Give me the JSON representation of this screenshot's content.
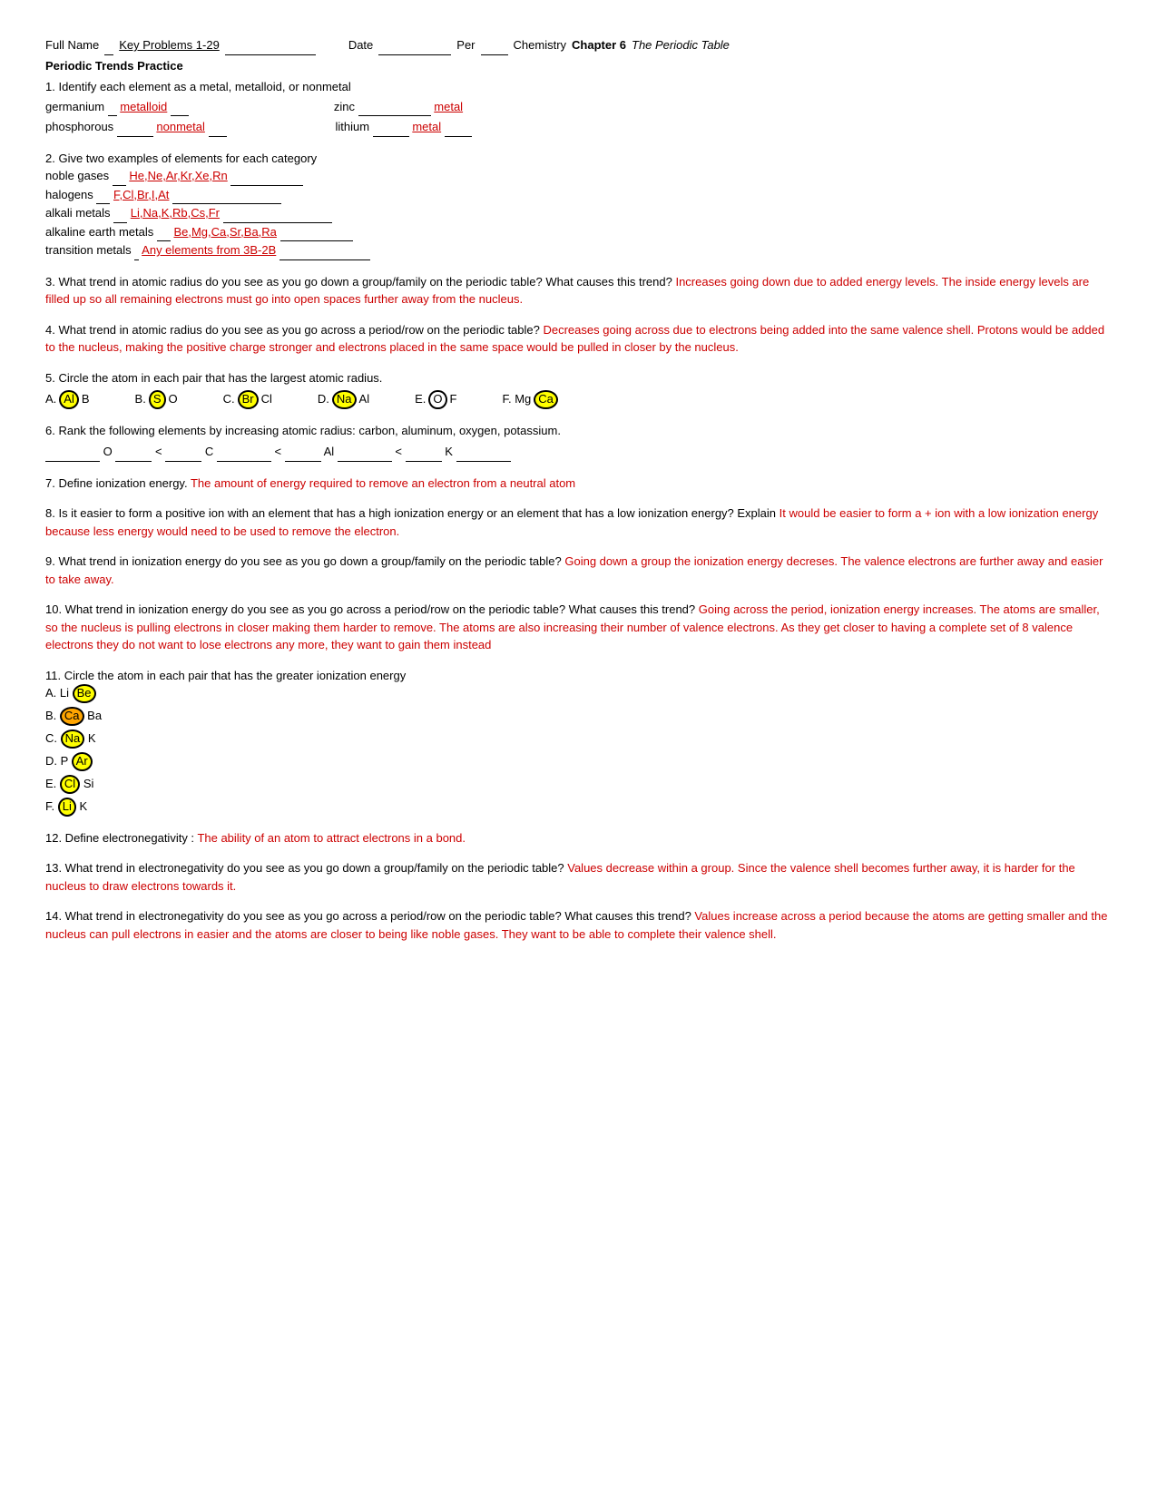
{
  "header": {
    "full_name_label": "Full Name",
    "full_name_value": "Key Problems 1-29",
    "date_label": "Date",
    "per_label": "Per",
    "course_bold": "Chapter 6",
    "course_italic": "The Periodic Table",
    "chemistry_label": "Chemistry"
  },
  "section_title": "Periodic Trends Practice",
  "questions": {
    "q1": {
      "text": "1. Identify each element as a metal, metalloid, or nonmetal",
      "items": [
        {
          "element": "germanium",
          "answer": "metalloid"
        },
        {
          "element": "zinc",
          "answer": "metal"
        },
        {
          "element": "phosphorous",
          "answer": "nonmetal"
        },
        {
          "element": "lithium",
          "answer": "metal"
        }
      ]
    },
    "q2": {
      "text": "2. Give two examples of elements for each category",
      "items": [
        {
          "category": "noble gases",
          "answer": "He,Ne,Ar,Kr,Xe,Rn"
        },
        {
          "category": "halogens",
          "answer": "F,Cl,Br,I,At"
        },
        {
          "category": "alkali metals",
          "answer": "Li,Na,K,Rb,Cs,Fr"
        },
        {
          "category": "alkaline earth metals",
          "answer": "Be,Mg,Ca,Sr,Ba,Ra"
        },
        {
          "category": "transition metals",
          "answer": "Any elements from 3B-2B"
        }
      ]
    },
    "q3": {
      "text": "3. What trend in atomic radius do you see as you go down a group/family on the periodic table? What causes this trend?",
      "answer": "Increases going down due to added energy levels.  The inside energy levels are filled up so all remaining electrons must go into open spaces further away from the nucleus."
    },
    "q4": {
      "text": "4. What trend in atomic radius do you see as you go across a period/row on the periodic table?",
      "answer": "Decreases going across due to electrons being added into the same valence shell.  Protons would be added to the nucleus, making the positive charge stronger and electrons placed in the same space would be pulled in closer by the nucleus."
    },
    "q5": {
      "text": "5. Circle the atom in each pair that has the largest atomic radius.",
      "pairs": [
        {
          "label": "A.",
          "items": [
            {
              "val": "Al",
              "circled": true
            },
            {
              "val": "B",
              "circled": false
            }
          ]
        },
        {
          "label": "B.",
          "items": [
            {
              "val": "S",
              "circled": false
            },
            {
              "val": "O",
              "circled": false
            }
          ]
        },
        {
          "label": "C.",
          "items": [
            {
              "val": "Br",
              "circled": true
            },
            {
              "val": "Cl",
              "circled": false
            }
          ]
        },
        {
          "label": "D.",
          "items": [
            {
              "val": "Na",
              "circled": true
            },
            {
              "val": "Al",
              "circled": false
            }
          ]
        },
        {
          "label": "E.",
          "items": [
            {
              "val": "O",
              "circled": false
            },
            {
              "val": "F",
              "circled": false
            }
          ]
        },
        {
          "label": "F.",
          "items": [
            {
              "val": "Mg",
              "circled": false
            },
            {
              "val": "Ca",
              "circled": true
            }
          ]
        }
      ]
    },
    "q6": {
      "text": "6. Rank the following elements by increasing atomic radius: carbon, aluminum, oxygen, potassium.",
      "ranking": "___________O_________<_________C___________<_________Al___________<_______K___________"
    },
    "q7": {
      "text": "7. Define ionization energy.",
      "answer": "The amount of energy required to remove an electron from a neutral atom"
    },
    "q8": {
      "text": "8. Is it easier to form a positive ion with an element that has a high ionization energy or an element that has a low ionization energy? Explain",
      "answer": "It would be easier to form a + ion with a low ionization energy because less energy would need to be used to remove the electron."
    },
    "q9": {
      "text": "9. What trend in ionization energy do you see as you go down a group/family on the periodic table?",
      "answer": "Going down a group the ionization energy decreses.  The valence electrons are further away and easier to take away."
    },
    "q10": {
      "text": "10. What trend in ionization energy do you see as you go across a period/row on the periodic table? What causes this trend?",
      "answer": "Going across the period, ionization energy increases.  The atoms are smaller, so the nucleus is pulling electrons in closer making them harder to remove.  The atoms are also increasing their number of valence electrons.  As they get closer to having a complete set of 8 valence electrons they do not want to lose electrons any more, they want to gain them instead"
    },
    "q11": {
      "text": "11. Circle the atom in each pair that has the greater ionization energy",
      "pairs": [
        {
          "label": "A. Li",
          "circled": "Be"
        },
        {
          "label": "B.",
          "first": "Ca",
          "circled_first": true,
          "second": "Ba"
        },
        {
          "label": "C.",
          "first": "Na",
          "circled_first": true,
          "second": "K"
        },
        {
          "label": "D. P",
          "circled": "Ar"
        },
        {
          "label": "E.",
          "first": "Cl",
          "circled_first": true,
          "second": "Si"
        },
        {
          "label": "F.",
          "first": "Li",
          "circled_first": true,
          "second": "K"
        }
      ]
    },
    "q12": {
      "text": "12. Define electronegativity :",
      "answer": "The ability of an atom to attract electrons in a bond."
    },
    "q13": {
      "text": "13. What trend in electronegativity do you see as you go down a group/family on the periodic table?",
      "answer": "Values decrease within a group.  Since the valence shell becomes further away, it is harder for the nucleus to draw electrons towards it."
    },
    "q14": {
      "text": "14. What trend in electronegativity do you see as you go across a period/row on the periodic table? What causes this trend?",
      "answer": "Values increase across a period because the atoms are getting smaller and the nucleus can pull electrons in easier and the atoms are closer to being like noble gases.  They want to be able to complete their valence shell."
    }
  }
}
